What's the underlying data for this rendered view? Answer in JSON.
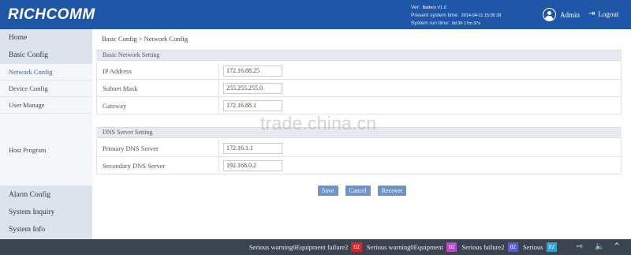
{
  "header": {
    "logo": "RICHCOMM",
    "version_label": "Ver:",
    "version_value": "Battery V1.0",
    "system_time_label": "Present system time:",
    "system_time_value": "2014-04-11 15:00 39",
    "run_time_label": "System run time:",
    "run_time_value": "0d 3h 17m 37s",
    "user": "Admin",
    "logout": "Logout"
  },
  "sidebar": {
    "items": [
      {
        "label": "Home"
      },
      {
        "label": "Basic Config"
      },
      {
        "label": "Network Config"
      },
      {
        "label": "Device Config"
      },
      {
        "label": "User Manage"
      },
      {
        "label": "Host Program"
      },
      {
        "label": "Alarm Config"
      },
      {
        "label": "System Inquiry"
      },
      {
        "label": "System Info"
      }
    ]
  },
  "breadcrumb": "Basic Config > Network Config",
  "sections": {
    "basic": "Basic Network Setting",
    "dns": "DNS Server Setting"
  },
  "basic_fields": [
    {
      "label": "IP Address",
      "value": "172.16.88.25"
    },
    {
      "label": "Subnet Mask",
      "value": "255.255.255.0"
    },
    {
      "label": "Gateway",
      "value": "172.16.88.1"
    }
  ],
  "dns_fields": [
    {
      "label": "Primary DNS Server",
      "value": "172.16.1.1"
    },
    {
      "label": "Secondary DNS Server",
      "value": "192.168.0.2"
    }
  ],
  "buttons": {
    "save": "Save",
    "cancel": "Cancel",
    "recover": "Recover"
  },
  "watermark": "trade.china.cn",
  "footer": {
    "alarms": [
      {
        "label": "Serious warning0Equipment failure2",
        "count": "02",
        "color": "#d9222a"
      },
      {
        "label": "Serious warning0Equipment",
        "count": "02",
        "color": "#b64bc4"
      },
      {
        "label": "Serious failure2",
        "count": "02",
        "color": "#5a5fc8"
      },
      {
        "label": "Serious",
        "count": "02",
        "color": "#27a5d6"
      }
    ]
  }
}
